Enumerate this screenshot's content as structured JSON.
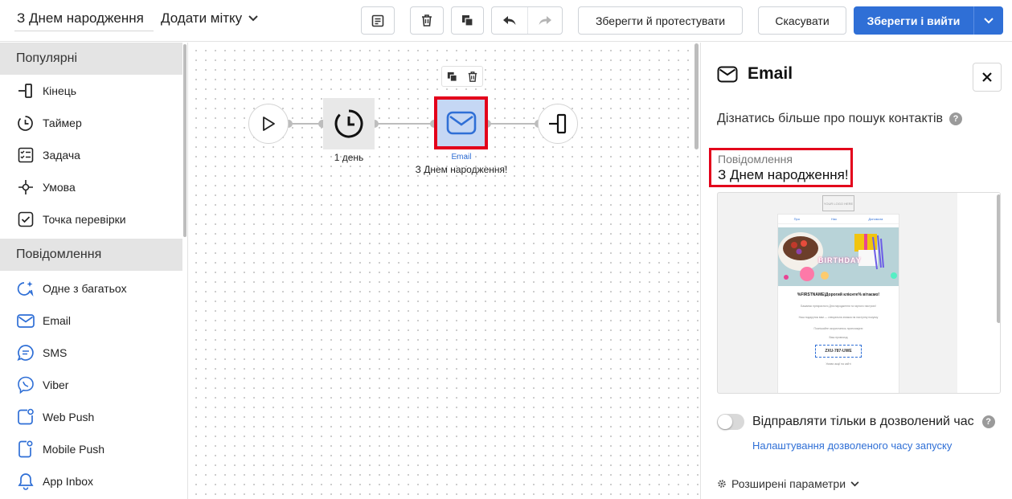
{
  "header": {
    "name_value": "З Днем народження",
    "tag_label": "Додати мітку",
    "save_test_label": "Зберегти й протестувати",
    "cancel_label": "Скасувати",
    "save_exit_label": "Зберегти і вийти"
  },
  "sidebar": {
    "sections": [
      {
        "title": "Популярні",
        "items": [
          {
            "label": "Кінець",
            "icon": "exit-icon"
          },
          {
            "label": "Таймер",
            "icon": "timer-icon"
          },
          {
            "label": "Задача",
            "icon": "task-list-icon"
          },
          {
            "label": "Умова",
            "icon": "condition-icon"
          },
          {
            "label": "Точка перевірки",
            "icon": "checkpoint-icon"
          }
        ]
      },
      {
        "title": "Повідомлення",
        "items": [
          {
            "label": "Одне з багатьох",
            "icon": "sparkle-chat-icon"
          },
          {
            "label": "Email",
            "icon": "envelope-icon"
          },
          {
            "label": "SMS",
            "icon": "sms-icon"
          },
          {
            "label": "Viber",
            "icon": "viber-icon"
          },
          {
            "label": "Web Push",
            "icon": "web-push-icon"
          },
          {
            "label": "Mobile Push",
            "icon": "mobile-push-icon"
          },
          {
            "label": "App Inbox",
            "icon": "bell-icon"
          }
        ]
      }
    ]
  },
  "canvas": {
    "timer_label": "1 день",
    "email_type_label": "Email",
    "email_name_label": "З Днем народження!"
  },
  "panel": {
    "title": "Email",
    "learn_more": "Дізнатись більше про пошук контактів",
    "message_label": "Повідомлення",
    "message_value": "З Днем народження!",
    "preview": {
      "logo_text": "YOUR LOGO HERE",
      "nav": [
        "Про",
        "Нас",
        "Допомога"
      ],
      "birthday_banner": "BIRTHDAY",
      "heading": "%FIRSTNAME|Дорогий клієнте% вітаємо!",
      "para1": "Бажаємо прекрасного Дня народження та гарного настрою!",
      "para2": "Наш подарунок вам — спеціальна знижка на наступну покупку",
      "para3": "Поспішайте скористатись пропозицією",
      "small": "Ваш промокод",
      "promo_code": "ZXU-787-UWE",
      "footer": "Умови акції на сайті"
    },
    "toggle_label": "Відправляти тільки в дозволений час",
    "toggle_on": false,
    "time_link": "Налаштування дозволеного часу запуску",
    "advanced": "Розширені параметри"
  },
  "colors": {
    "primary": "#2f6fd6",
    "highlight": "#e3001b",
    "selected_node": "#c5d7f4"
  }
}
